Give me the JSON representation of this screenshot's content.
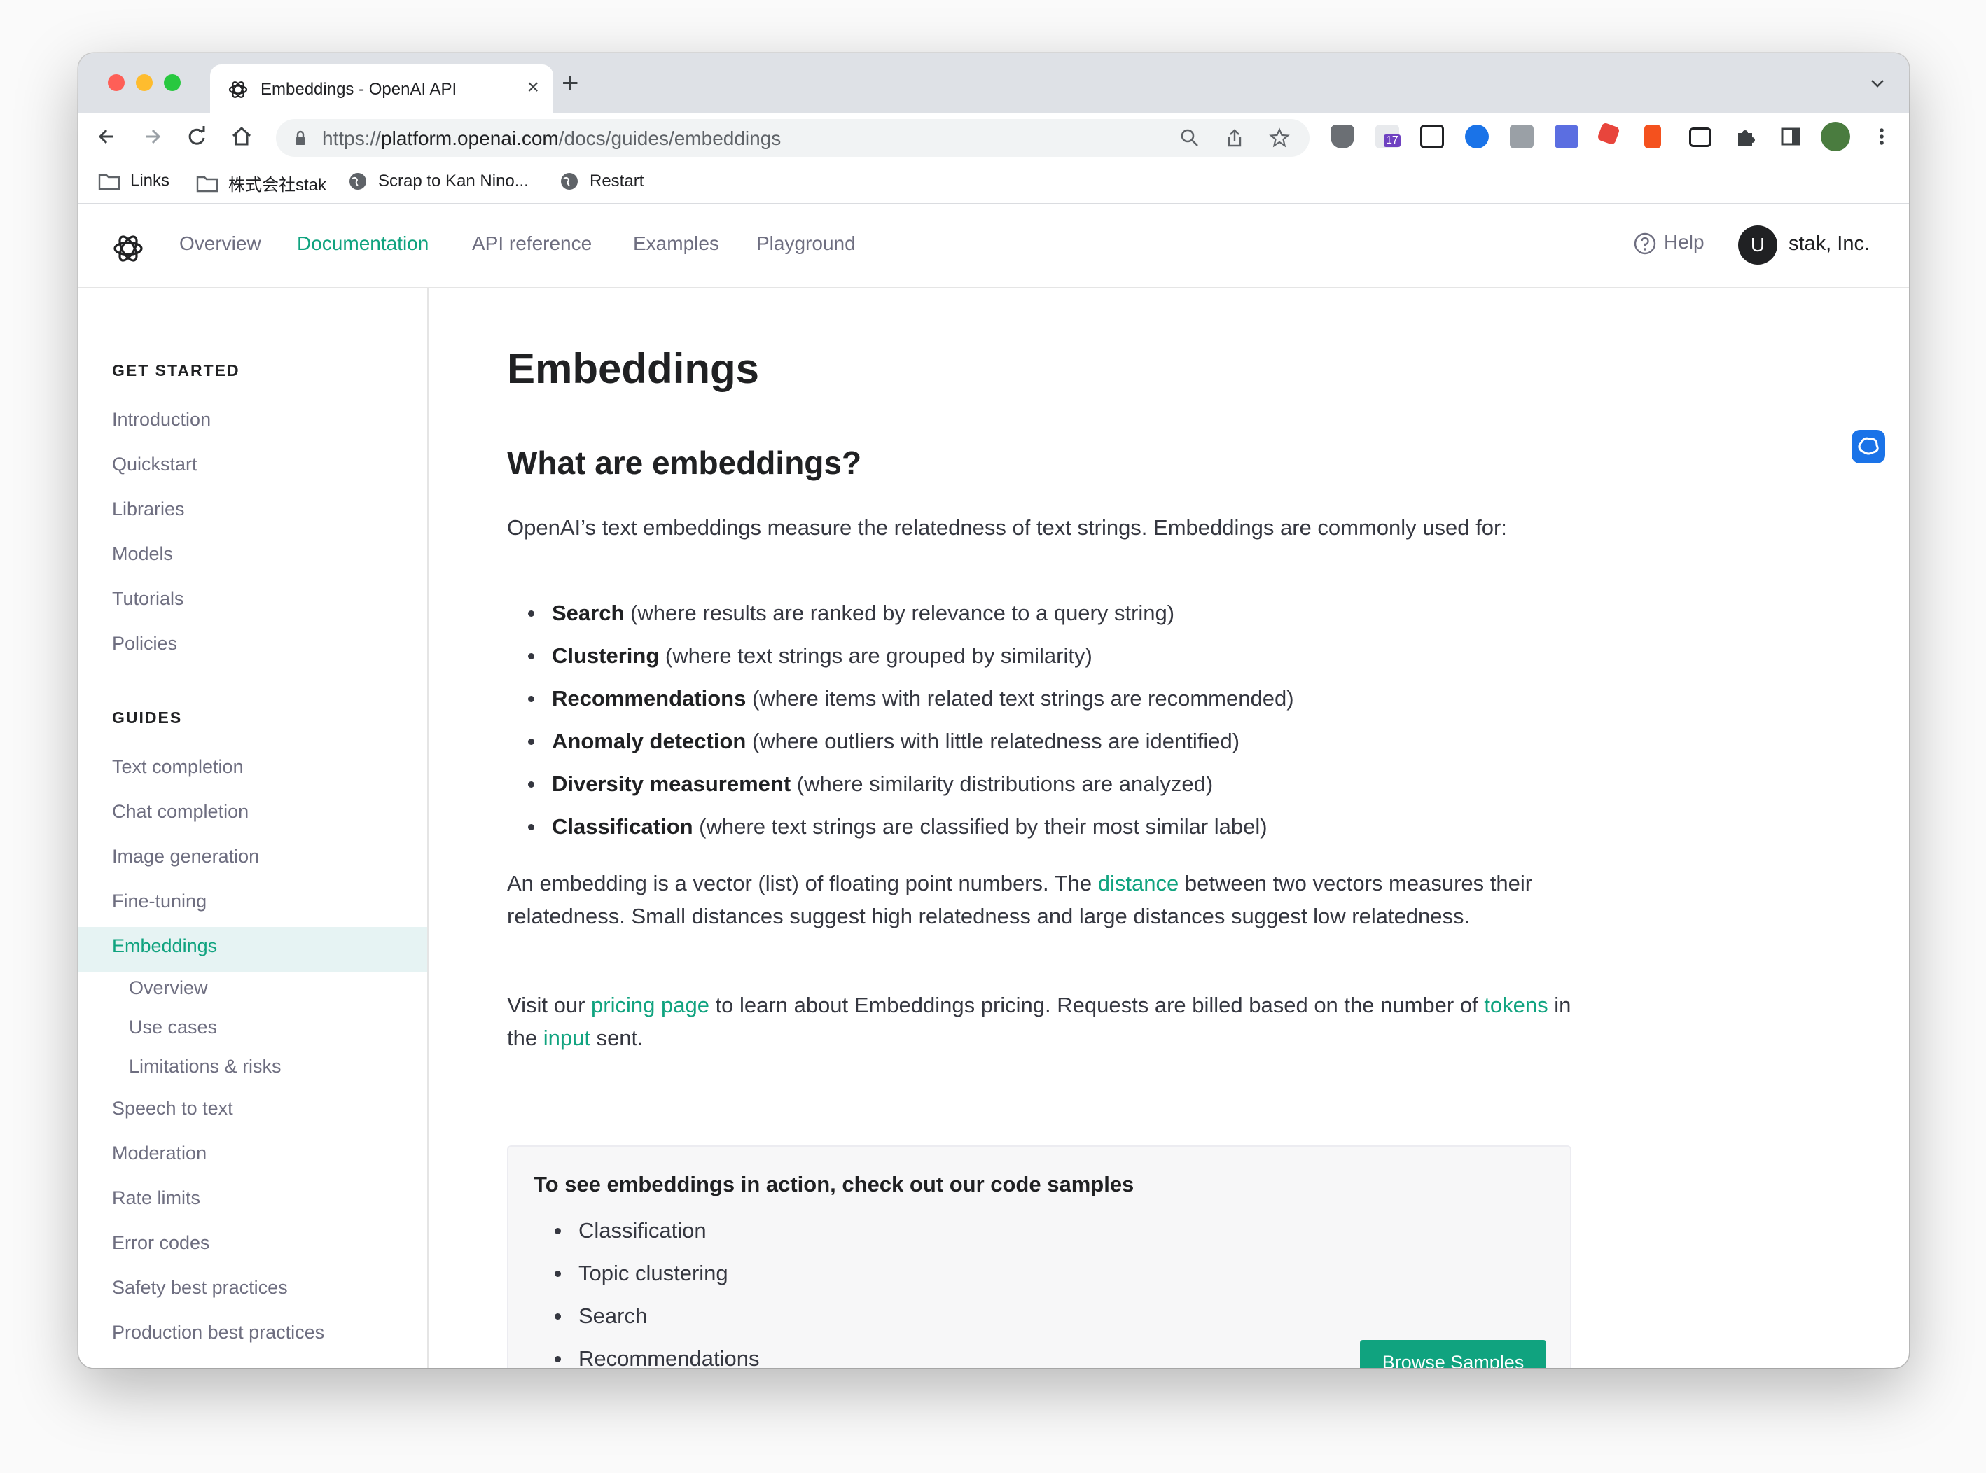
{
  "browser": {
    "tab_title": "Embeddings - OpenAI API",
    "url_scheme": "https://",
    "url_host": "platform.openai.com",
    "url_path": "/docs/guides/embeddings",
    "extension_badge": "17",
    "bookmarks": [
      "Links",
      "株式会社stak",
      "Scrap to Kan Nino...",
      "Restart"
    ]
  },
  "header": {
    "nav": [
      "Overview",
      "Documentation",
      "API reference",
      "Examples",
      "Playground"
    ],
    "active_nav": "Documentation",
    "help": "Help",
    "avatar_initial": "U",
    "org_name": "stak, Inc."
  },
  "sidebar": {
    "get_started_heading": "GET STARTED",
    "get_started": [
      "Introduction",
      "Quickstart",
      "Libraries",
      "Models",
      "Tutorials",
      "Policies"
    ],
    "guides_heading": "GUIDES",
    "guides_before": [
      "Text completion",
      "Chat completion",
      "Image generation",
      "Fine-tuning"
    ],
    "active_item": "Embeddings",
    "active_subitems": [
      "Overview",
      "Use cases",
      "Limitations & risks"
    ],
    "guides_after": [
      "Speech to text",
      "Moderation",
      "Rate limits",
      "Error codes",
      "Safety best practices",
      "Production best practices"
    ]
  },
  "main": {
    "title": "Embeddings",
    "subtitle": "What are embeddings?",
    "intro": "OpenAI’s text embeddings measure the relatedness of text strings. Embeddings are commonly used for:",
    "uses": [
      {
        "term": "Search",
        "desc": " (where results are ranked by relevance to a query string)"
      },
      {
        "term": "Clustering",
        "desc": " (where text strings are grouped by similarity)"
      },
      {
        "term": "Recommendations",
        "desc": " (where items with related text strings are recommended)"
      },
      {
        "term": "Anomaly detection",
        "desc": " (where outliers with little relatedness are identified)"
      },
      {
        "term": "Diversity measurement",
        "desc": " (where similarity distributions are analyzed)"
      },
      {
        "term": "Classification",
        "desc": " (where text strings are classified by their most similar label)"
      }
    ],
    "vector_p": {
      "before": "An embedding is a vector (list) of floating point numbers. The ",
      "link": "distance",
      "after": " between two vectors measures their relatedness. Small distances suggest high relatedness and large distances suggest low relatedness."
    },
    "pricing_p": {
      "t1": "Visit our ",
      "link1": "pricing page",
      "t2": " to learn about Embeddings pricing. Requests are billed based on the number of ",
      "link2": "tokens",
      "t3": " in the ",
      "link3": "input",
      "t4": " sent."
    },
    "samples": {
      "title": "To see embeddings in action, check out our code samples",
      "items": [
        "Classification",
        "Topic clustering",
        "Search",
        "Recommendations"
      ],
      "button": "Browse Samples"
    }
  }
}
